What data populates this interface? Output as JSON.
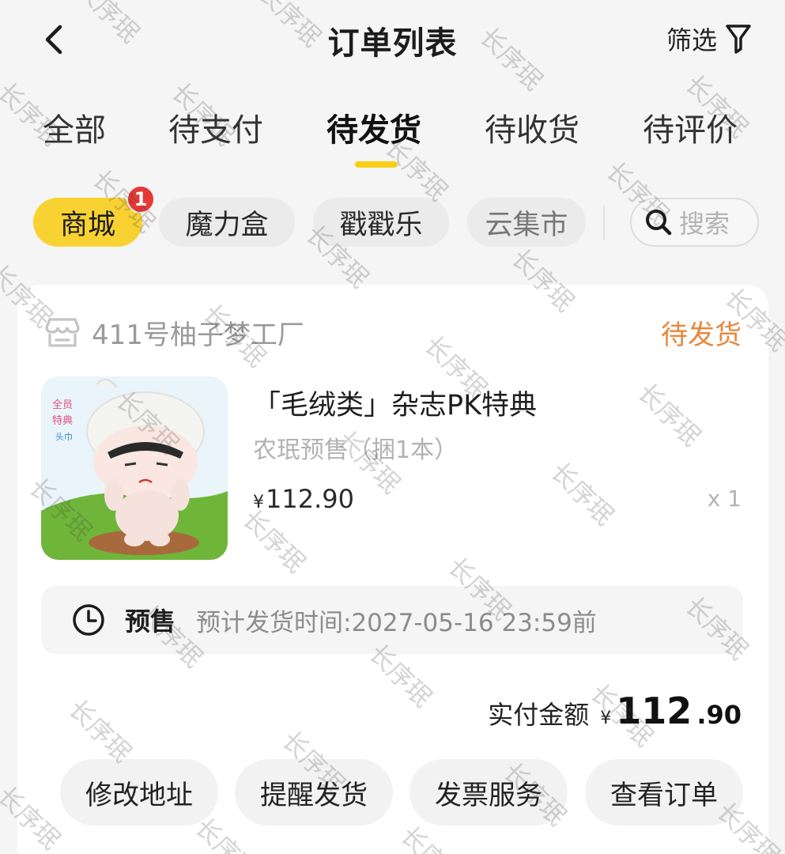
{
  "header": {
    "title": "订单列表",
    "filter_label": "筛选"
  },
  "tabs": [
    {
      "label": "全部",
      "active": false
    },
    {
      "label": "待支付",
      "active": false
    },
    {
      "label": "待发货",
      "active": true
    },
    {
      "label": "待收货",
      "active": false
    },
    {
      "label": "待评价",
      "active": false
    }
  ],
  "chips": [
    {
      "label": "商城",
      "active": true,
      "badge": "1"
    },
    {
      "label": "魔力盒",
      "active": false
    },
    {
      "label": "戳戳乐",
      "active": false
    },
    {
      "label": "云集市",
      "active": false
    }
  ],
  "search": {
    "placeholder": "搜索"
  },
  "order": {
    "shop_name": "411号柚子梦工厂",
    "status": "待发货",
    "product": {
      "title": "「毛绒类」杂志PK特典",
      "subtitle": "农珉预售（捆1本）",
      "currency": "¥",
      "price": "112.90",
      "quantity": "x 1"
    },
    "presale": {
      "label": "预售",
      "ship_time": "预计发货时间:2027-05-16 23:59前"
    },
    "total": {
      "label": "实付金额",
      "currency": "¥",
      "integer": "112",
      "decimal": ".90"
    },
    "actions": [
      "修改地址",
      "提醒发货",
      "发票服务",
      "查看订单"
    ]
  },
  "watermark": "长序珉",
  "colors": {
    "accent_yellow": "#f8d232",
    "status_orange": "#e8863c",
    "badge_red": "#e53935"
  },
  "icons": {
    "back": "chevron-left-icon",
    "filter": "funnel-icon",
    "search": "search-icon",
    "shop": "store-icon",
    "clock": "clock-icon"
  }
}
